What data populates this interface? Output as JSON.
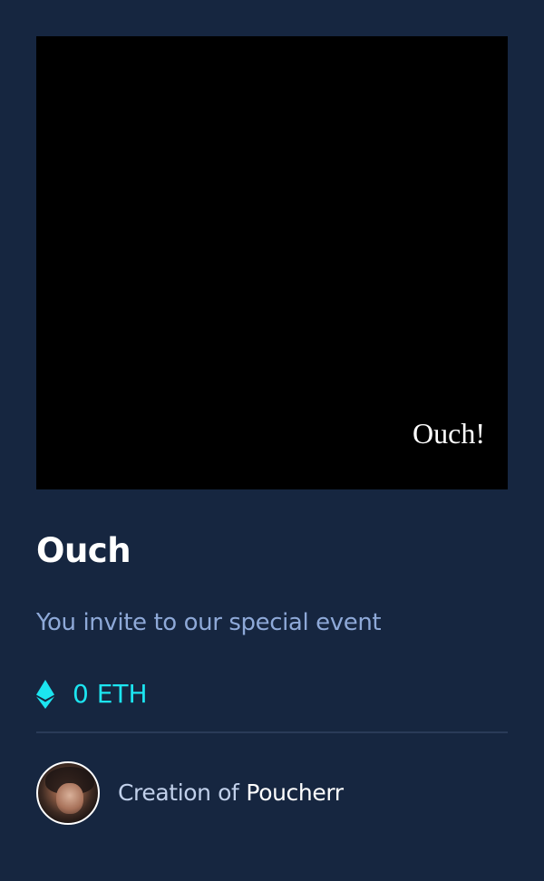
{
  "media": {
    "caption": "Ouch!",
    "background_color": "#000000"
  },
  "nft": {
    "title": "Ouch",
    "description": "You invite to our special event",
    "price": "0 ETH",
    "currency_icon": "ethereum-icon"
  },
  "creator": {
    "prefix": "Creation of",
    "name": "Poucherr",
    "avatar": "avatar-portrait"
  },
  "colors": {
    "background": "#162640",
    "accent": "#1ce4f0",
    "description": "#8ea9d8",
    "divider": "#2a3b58"
  }
}
